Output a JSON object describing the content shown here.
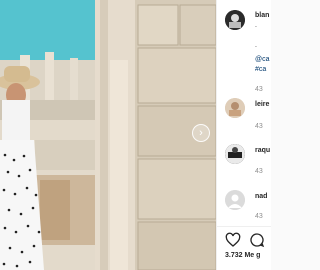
{
  "post": {
    "author": "blan",
    "caption_lines": [
      ".",
      "."
    ],
    "mention": "@ca",
    "hashtag": "#ca",
    "time": "43"
  },
  "comments": [
    {
      "user": "leire",
      "time": "43"
    },
    {
      "user": "raqu",
      "time": "43"
    },
    {
      "user": "nad",
      "time": "43"
    }
  ],
  "footer": {
    "likes": "3.732 Me g"
  },
  "icons": {
    "next": "chevron-right-icon",
    "like": "heart-icon",
    "comment": "comment-icon"
  }
}
